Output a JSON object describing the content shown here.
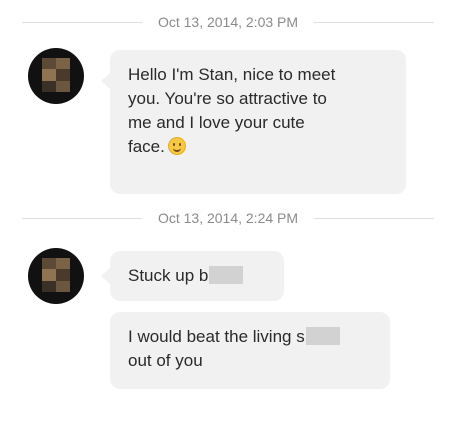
{
  "timestamps": [
    {
      "text": "Oct 13, 2014, 2:03 PM"
    },
    {
      "text": "Oct 13, 2014, 2:24 PM"
    }
  ],
  "messages": [
    {
      "lines": [
        "Hello I'm Stan, nice to meet",
        "you. You're so attractive to",
        "me and I love your cute",
        "face."
      ],
      "emoji": "smiley-icon"
    },
    {
      "text_before_censor": "Stuck up b",
      "censored": true
    },
    {
      "line1_before_censor": "I would beat the living s",
      "line2": "out of you",
      "censored": true
    }
  ],
  "colors": {
    "bubble": "#f1f1f1",
    "timestamp": "#8a8a8a",
    "divider": "#dedede",
    "censor": "#d2d2d2"
  }
}
